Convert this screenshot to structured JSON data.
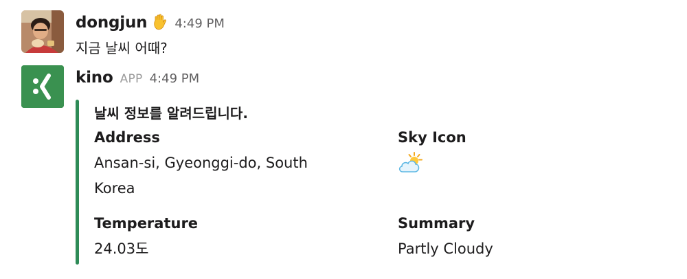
{
  "messages": [
    {
      "username": "dongjun",
      "timestamp": "4:49 PM",
      "text": "지금 날씨 어때?"
    },
    {
      "username": "kino",
      "badge": "APP",
      "timestamp": "4:49 PM",
      "attachment": {
        "accent_color": "#2e8b57",
        "title": "날씨 정보를 알려드립니다.",
        "fields": {
          "address_label": "Address",
          "address_line1": "Ansan-si, Gyeonggi-do, South",
          "address_line2": "Korea",
          "sky_icon_label": "Sky Icon",
          "sky_icon": "partly-cloudy-icon",
          "temperature_label": "Temperature",
          "temperature_value": "24.03도",
          "summary_label": "Summary",
          "summary_value": "Partly Cloudy"
        }
      }
    }
  ],
  "icons": {
    "user_status_emoji": "hand-emoji-icon",
    "app_logo": "kino-logo-icon"
  }
}
